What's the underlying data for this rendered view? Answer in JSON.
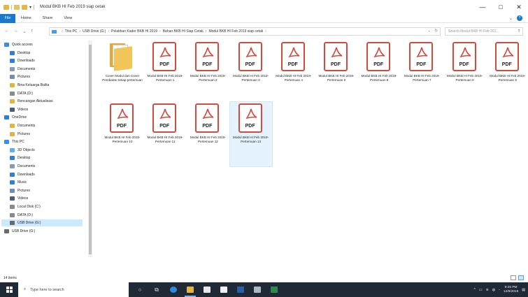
{
  "window": {
    "title": "Modul BKB HI Feb 2019 siap cetak",
    "minimize": "—",
    "maximize": "□",
    "close": "✕"
  },
  "ribbon": {
    "tabs": [
      "File",
      "Home",
      "Share",
      "View"
    ]
  },
  "address": {
    "crumbs": [
      "This PC",
      "USB Drive (G:)",
      "Pelatihan Kader BKB HI 2019",
      "Bahan BKB HI Siap Cetak",
      "Modul BKB HI Feb 2019 siap cetak"
    ],
    "search_placeholder": "Search Modul BKB HI Feb 201..."
  },
  "nav": {
    "items": [
      {
        "label": "Quick access",
        "icon": "star-icon",
        "color": "#3a8ee6",
        "level": 0
      },
      {
        "label": "Desktop",
        "icon": "desktop-icon",
        "color": "#2f7fd8",
        "level": 1,
        "pinned": true
      },
      {
        "label": "Downloads",
        "icon": "download-icon",
        "color": "#2f7fd8",
        "level": 1,
        "pinned": true
      },
      {
        "label": "Documents",
        "icon": "documents-icon",
        "color": "#8a9bb0",
        "level": 1,
        "pinned": true
      },
      {
        "label": "Pictures",
        "icon": "pictures-icon",
        "color": "#6c8fb8",
        "level": 1,
        "pinned": true
      },
      {
        "label": "Bina Keluarga Balita",
        "icon": "folder-icon",
        "color": "#e5b340",
        "level": 1
      },
      {
        "label": "DATA (D:)",
        "icon": "drive-icon",
        "color": "#8a8a8a",
        "level": 1
      },
      {
        "label": "Rencangan Aktualisasi",
        "icon": "folder-icon",
        "color": "#e5b340",
        "level": 1
      },
      {
        "label": "Videos",
        "icon": "videos-icon",
        "color": "#4d5e78",
        "level": 1
      },
      {
        "label": "OneDrive",
        "icon": "cloud-icon",
        "color": "#2f7fd8",
        "level": 0
      },
      {
        "label": "Documents",
        "icon": "folder-icon",
        "color": "#e5b340",
        "level": 1
      },
      {
        "label": "Pictures",
        "icon": "folder-icon",
        "color": "#e5b340",
        "level": 1
      },
      {
        "label": "This PC",
        "icon": "computer-icon",
        "color": "#3a8ee6",
        "level": 0
      },
      {
        "label": "3D Objects",
        "icon": "3d-objects-icon",
        "color": "#5ab0f0",
        "level": 1
      },
      {
        "label": "Desktop",
        "icon": "desktop-icon",
        "color": "#2f7fd8",
        "level": 1
      },
      {
        "label": "Documents",
        "icon": "documents-icon",
        "color": "#8a9bb0",
        "level": 1
      },
      {
        "label": "Downloads",
        "icon": "download-icon",
        "color": "#2f7fd8",
        "level": 1
      },
      {
        "label": "Music",
        "icon": "music-icon",
        "color": "#2f7fd8",
        "level": 1
      },
      {
        "label": "Pictures",
        "icon": "pictures-icon",
        "color": "#6c8fb8",
        "level": 1
      },
      {
        "label": "Videos",
        "icon": "videos-icon",
        "color": "#4d5e78",
        "level": 1
      },
      {
        "label": "Local Disk (C:)",
        "icon": "drive-icon",
        "color": "#8a8a8a",
        "level": 1
      },
      {
        "label": "DATA (D:)",
        "icon": "drive-icon",
        "color": "#8a8a8a",
        "level": 1
      },
      {
        "label": "USB Drive (G:)",
        "icon": "usb-drive-icon",
        "color": "#6a6a6a",
        "level": 1,
        "selected": true
      },
      {
        "label": "USB Drive (G:)",
        "icon": "usb-drive-icon",
        "color": "#6a6a6a",
        "level": 0
      }
    ]
  },
  "files": [
    {
      "type": "folder",
      "label": "Cover Modul dan Cover Pembatas setiap pertemuan"
    },
    {
      "type": "pdf",
      "label": "Modul BKB HI Feb 2019-Pertemuan 1"
    },
    {
      "type": "pdf",
      "label": "Modul BKB HI Feb 2019-Pertemuan 2"
    },
    {
      "type": "pdf",
      "label": "Modul BKB HI Feb 2019-Pertemuan 3"
    },
    {
      "type": "pdf",
      "label": "Modul BKB HI Feb 2019-Pertemuan 4"
    },
    {
      "type": "pdf",
      "label": "Modul BKB HI Feb 2019-Pertemuan 5"
    },
    {
      "type": "pdf",
      "label": "Modul BKB HI Feb 2019-Pertemuan 6"
    },
    {
      "type": "pdf",
      "label": "Modul BKB HI Feb 2019-Pertemuan 7"
    },
    {
      "type": "pdf",
      "label": "Modul BKB HI Feb 2019-Pertemuan 8"
    },
    {
      "type": "pdf",
      "label": "Modul BKB HI Feb 2019-Pertemuan 9"
    },
    {
      "type": "pdf",
      "label": "Modul BKB HI Feb 2019-Pertemuan 10"
    },
    {
      "type": "pdf",
      "label": "Modul BKB HI Feb 2019-Pertemuan 11"
    },
    {
      "type": "pdf",
      "label": "Modul BKB HI Feb 2019-Pertemuan 12"
    },
    {
      "type": "pdf",
      "label": "Modul BKB HI Feb 2019-Pertemuan 13",
      "selected": true
    }
  ],
  "pdf_badge": "PDF",
  "status": {
    "item_count": "14 items"
  },
  "taskbar": {
    "search_placeholder": "Type here to search",
    "time": "9:25 PM",
    "date": "12/9/2019"
  },
  "colors": {
    "accent": "#1979ca",
    "pdf_red": "#d44a3f",
    "taskbar": "#1f2a36"
  }
}
